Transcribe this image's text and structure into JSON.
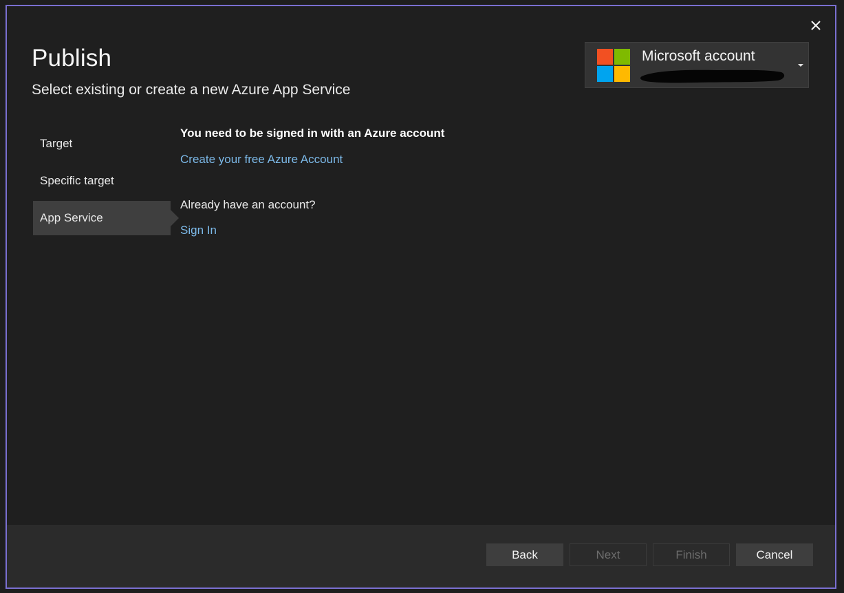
{
  "dialog": {
    "title": "Publish",
    "subtitle": "Select existing or create a new Azure App Service"
  },
  "account": {
    "label": "Microsoft account",
    "logo_colors": [
      "#f25022",
      "#7fba00",
      "#00a4ef",
      "#ffb900"
    ]
  },
  "nav": {
    "items": [
      {
        "label": "Target"
      },
      {
        "label": "Specific target"
      },
      {
        "label": "App Service"
      }
    ],
    "active_index": 2
  },
  "content": {
    "heading": "You need to be signed in with an Azure account",
    "create_link": "Create your free Azure Account",
    "have_account": "Already have an account?",
    "signin_link": "Sign In"
  },
  "footer": {
    "back": "Back",
    "next": "Next",
    "finish": "Finish",
    "cancel": "Cancel"
  },
  "colors": {
    "accent_border": "#7a6fd1",
    "link": "#7cb9e8",
    "background": "#1f1f1f"
  },
  "icons": {
    "close": "close-icon",
    "chevron": "chevron-down-icon",
    "logo": "microsoft-logo-icon"
  }
}
